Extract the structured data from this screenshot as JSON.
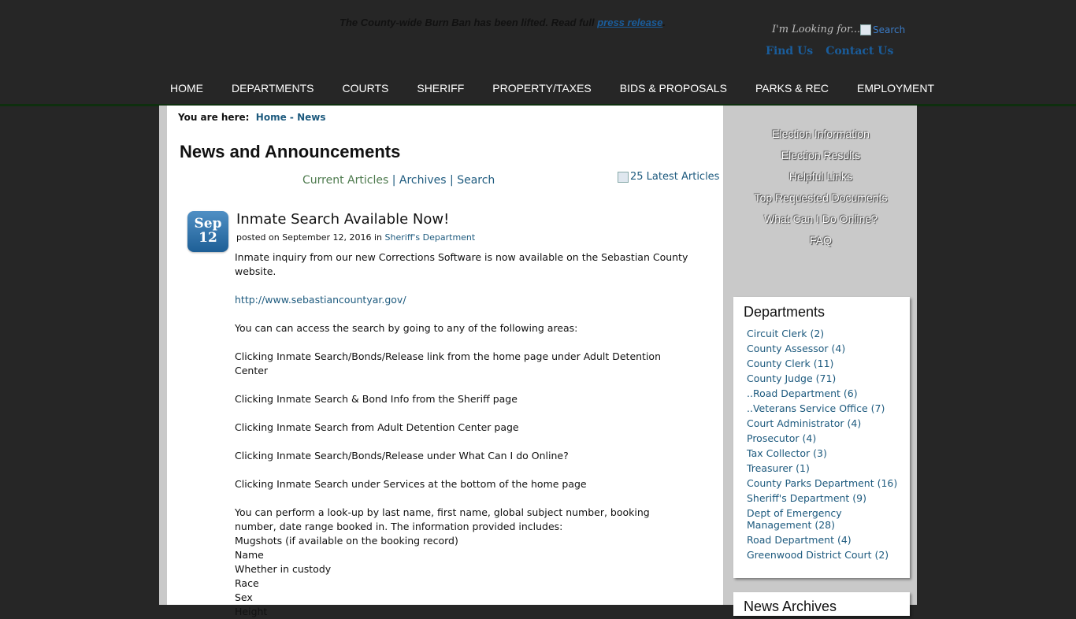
{
  "alert": {
    "text": "The County-wide Burn Ban has been lifted. Read full ",
    "link": "press release",
    "end": "."
  },
  "header": {
    "looking_for": "I'm Looking for...",
    "search_alt": "Search",
    "find_us": "Find Us",
    "contact_us": "Contact Us"
  },
  "nav": [
    "HOME",
    "DEPARTMENTS",
    "COURTS",
    "SHERIFF",
    "PROPERTY/TAXES",
    "BIDS & PROPOSALS",
    "PARKS & REC",
    "EMPLOYMENT"
  ],
  "breadcrumb": {
    "label": "You are here:",
    "home": "Home",
    "sep": "-",
    "current": "News"
  },
  "page_title": "News and Announcements",
  "subnav": {
    "current": "Current Articles",
    "sep1": "|",
    "archives": "Archives",
    "sep2": "|",
    "search": "Search"
  },
  "latest_alt": "25 Latest Articles",
  "article": {
    "month": "Sep",
    "day": "12",
    "title": "Inmate Search Available Now!",
    "meta_prefix": "posted on September 12, 2016 in",
    "category": "Sheriff's Department",
    "lines": [
      "Inmate inquiry from our new Corrections Software is now available on the Sebastian County website.",
      "",
      "http://www.sebastiancountyar.gov/",
      "",
      "You can can access the search by going to any of the following areas:",
      "",
      "Clicking Inmate Search/Bonds/Release link from the home page under Adult Detention Center",
      "",
      "Clicking Inmate Search & Bond Info from the Sheriff page",
      "",
      "Clicking Inmate Search from Adult Detention Center page",
      "",
      "Clicking Inmate Search/Bonds/Release under What Can I do Online?",
      "",
      "Clicking Inmate Search under Services at the bottom of the home page",
      "",
      "You can perform a look-up by last name, first name, global subject number, booking number, date range booked in. The information provided includes:",
      "Mugshots (if available on the booking record)",
      "Name",
      "Whether in custody",
      "Race",
      "Sex",
      "Height"
    ]
  },
  "sidebar_links": [
    "Election Information",
    "Election Results",
    "Helpful Links",
    "Top Requested Documents",
    "What Can I Do Online?",
    "FAQ"
  ],
  "departments": {
    "title": "Departments",
    "items": [
      "Circuit Clerk (2)",
      "County Assessor (4)",
      "County Clerk (11)",
      "County Judge (71)",
      "..Road Department (6)",
      "..Veterans Service Office (7)",
      "Court Administrator (4)",
      "Prosecutor (4)",
      "Tax Collector (3)",
      "Treasurer (1)",
      "County Parks Department (16)",
      "Sheriff's Department (9)",
      "Dept of Emergency Management (28)",
      "Road Department (4)",
      "Greenwood District Court (2)"
    ]
  },
  "archive_title": "News Archives"
}
